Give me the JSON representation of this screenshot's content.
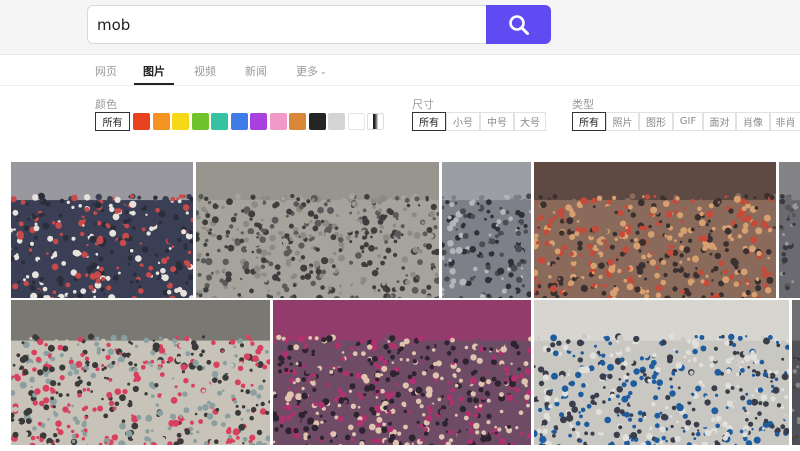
{
  "search": {
    "value": "mob",
    "button_icon": "search-icon"
  },
  "nav": {
    "tabs": [
      {
        "label": "网页",
        "active": false
      },
      {
        "label": "图片",
        "active": true
      },
      {
        "label": "视频",
        "active": false
      },
      {
        "label": "新闻",
        "active": false
      },
      {
        "label": "更多",
        "active": false,
        "icon": "chevron-down-icon"
      }
    ]
  },
  "filters": {
    "color": {
      "label": "颜色",
      "all_label": "所有",
      "swatches": [
        "#e8411d",
        "#f59220",
        "#f5d817",
        "#71c32b",
        "#34c2a0",
        "#3f7ce8",
        "#a941e0",
        "#f29ac7",
        "#d98739",
        "#252525",
        "#d4d4d4",
        "#ffffff",
        "black-white"
      ]
    },
    "size": {
      "label": "尺寸",
      "options": [
        "所有",
        "小号",
        "中号",
        "大号"
      ],
      "selected": "所有"
    },
    "type": {
      "label": "类型",
      "options": [
        "所有",
        "照片",
        "图形",
        "GIF",
        "面对",
        "肖像",
        "非肖"
      ],
      "selected": "所有"
    }
  },
  "results": [
    {
      "subject": "flash mob crowd closeup",
      "palette": [
        "#3a3f55",
        "#c94a4a",
        "#e8e2dc",
        "#2a2e3a"
      ]
    },
    {
      "subject": "flash mob in city square",
      "palette": [
        "#a6a39c",
        "#3d3d3d",
        "#8d8a84",
        "#5a5a5a"
      ]
    },
    {
      "subject": "crowd aerial dancing",
      "palette": [
        "#7d8088",
        "#2f3137",
        "#b5b6b9",
        "#4a4c52"
      ]
    },
    {
      "subject": "flash mob street crowd",
      "palette": [
        "#8a6a5a",
        "#c64a3a",
        "#3a3030",
        "#d7a070"
      ]
    },
    {
      "subject": "crowd partial",
      "palette": [
        "#6a6a70",
        "#3a3a40",
        "#999",
        "#555"
      ]
    },
    {
      "subject": "mall flash mob",
      "palette": [
        "#c8c3b8",
        "#d94060",
        "#3a3a3a",
        "#8aa0a0"
      ]
    },
    {
      "subject": "crowd hands raised",
      "palette": [
        "#6e4c66",
        "#e1c4b0",
        "#b03070",
        "#2e2430"
      ]
    },
    {
      "subject": "station flash mob aerial",
      "palette": [
        "#c9c7c2",
        "#3a3e4a",
        "#e2e0dc",
        "#1e5ca0"
      ]
    },
    {
      "subject": "crowd partial",
      "palette": [
        "#505058",
        "#2a2a30",
        "#888",
        "#444"
      ]
    }
  ]
}
